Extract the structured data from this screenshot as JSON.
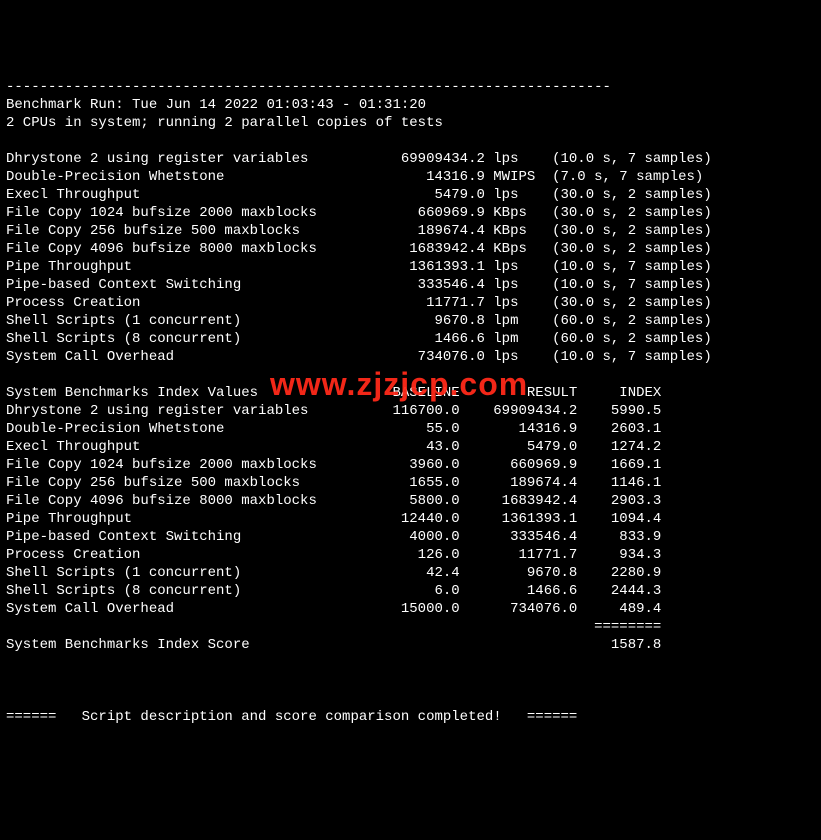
{
  "watermark": "www.zjzjcp.com",
  "hr_top": "------------------------------------------------------------------------",
  "run_line": "Benchmark Run: Tue Jun 14 2022 01:03:43 - 01:31:20",
  "cpu_line": "2 CPUs in system; running 2 parallel copies of tests",
  "results": [
    {
      "name": "Dhrystone 2 using register variables",
      "value": "69909434.2",
      "unit": "lps",
      "timing": "(10.0 s, 7 samples)"
    },
    {
      "name": "Double-Precision Whetstone",
      "value": "14316.9",
      "unit": "MWIPS",
      "timing": "(7.0 s, 7 samples)"
    },
    {
      "name": "Execl Throughput",
      "value": "5479.0",
      "unit": "lps",
      "timing": "(30.0 s, 2 samples)"
    },
    {
      "name": "File Copy 1024 bufsize 2000 maxblocks",
      "value": "660969.9",
      "unit": "KBps",
      "timing": "(30.0 s, 2 samples)"
    },
    {
      "name": "File Copy 256 bufsize 500 maxblocks",
      "value": "189674.4",
      "unit": "KBps",
      "timing": "(30.0 s, 2 samples)"
    },
    {
      "name": "File Copy 4096 bufsize 8000 maxblocks",
      "value": "1683942.4",
      "unit": "KBps",
      "timing": "(30.0 s, 2 samples)"
    },
    {
      "name": "Pipe Throughput",
      "value": "1361393.1",
      "unit": "lps",
      "timing": "(10.0 s, 7 samples)"
    },
    {
      "name": "Pipe-based Context Switching",
      "value": "333546.4",
      "unit": "lps",
      "timing": "(10.0 s, 7 samples)"
    },
    {
      "name": "Process Creation",
      "value": "11771.7",
      "unit": "lps",
      "timing": "(30.0 s, 2 samples)"
    },
    {
      "name": "Shell Scripts (1 concurrent)",
      "value": "9670.8",
      "unit": "lpm",
      "timing": "(60.0 s, 2 samples)"
    },
    {
      "name": "Shell Scripts (8 concurrent)",
      "value": "1466.6",
      "unit": "lpm",
      "timing": "(60.0 s, 2 samples)"
    },
    {
      "name": "System Call Overhead",
      "value": "734076.0",
      "unit": "lps",
      "timing": "(10.0 s, 7 samples)"
    }
  ],
  "idx_header_lbl": "System Benchmarks Index Values",
  "idx_col_baseline": "BASELINE",
  "idx_col_result": "RESULT",
  "idx_col_index": "INDEX",
  "index": [
    {
      "name": "Dhrystone 2 using register variables",
      "baseline": "116700.0",
      "result": "69909434.2",
      "index": "5990.5"
    },
    {
      "name": "Double-Precision Whetstone",
      "baseline": "55.0",
      "result": "14316.9",
      "index": "2603.1"
    },
    {
      "name": "Execl Throughput",
      "baseline": "43.0",
      "result": "5479.0",
      "index": "1274.2"
    },
    {
      "name": "File Copy 1024 bufsize 2000 maxblocks",
      "baseline": "3960.0",
      "result": "660969.9",
      "index": "1669.1"
    },
    {
      "name": "File Copy 256 bufsize 500 maxblocks",
      "baseline": "1655.0",
      "result": "189674.4",
      "index": "1146.1"
    },
    {
      "name": "File Copy 4096 bufsize 8000 maxblocks",
      "baseline": "5800.0",
      "result": "1683942.4",
      "index": "2903.3"
    },
    {
      "name": "Pipe Throughput",
      "baseline": "12440.0",
      "result": "1361393.1",
      "index": "1094.4"
    },
    {
      "name": "Pipe-based Context Switching",
      "baseline": "4000.0",
      "result": "333546.4",
      "index": "833.9"
    },
    {
      "name": "Process Creation",
      "baseline": "126.0",
      "result": "11771.7",
      "index": "934.3"
    },
    {
      "name": "Shell Scripts (1 concurrent)",
      "baseline": "42.4",
      "result": "9670.8",
      "index": "2280.9"
    },
    {
      "name": "Shell Scripts (8 concurrent)",
      "baseline": "6.0",
      "result": "1466.6",
      "index": "2444.3"
    },
    {
      "name": "System Call Overhead",
      "baseline": "15000.0",
      "result": "734076.0",
      "index": "489.4"
    }
  ],
  "score_rule": "========",
  "score_label": "System Benchmarks Index Score",
  "score_value": "1587.8",
  "footer": "======   Script description and score comparison completed!   ======"
}
